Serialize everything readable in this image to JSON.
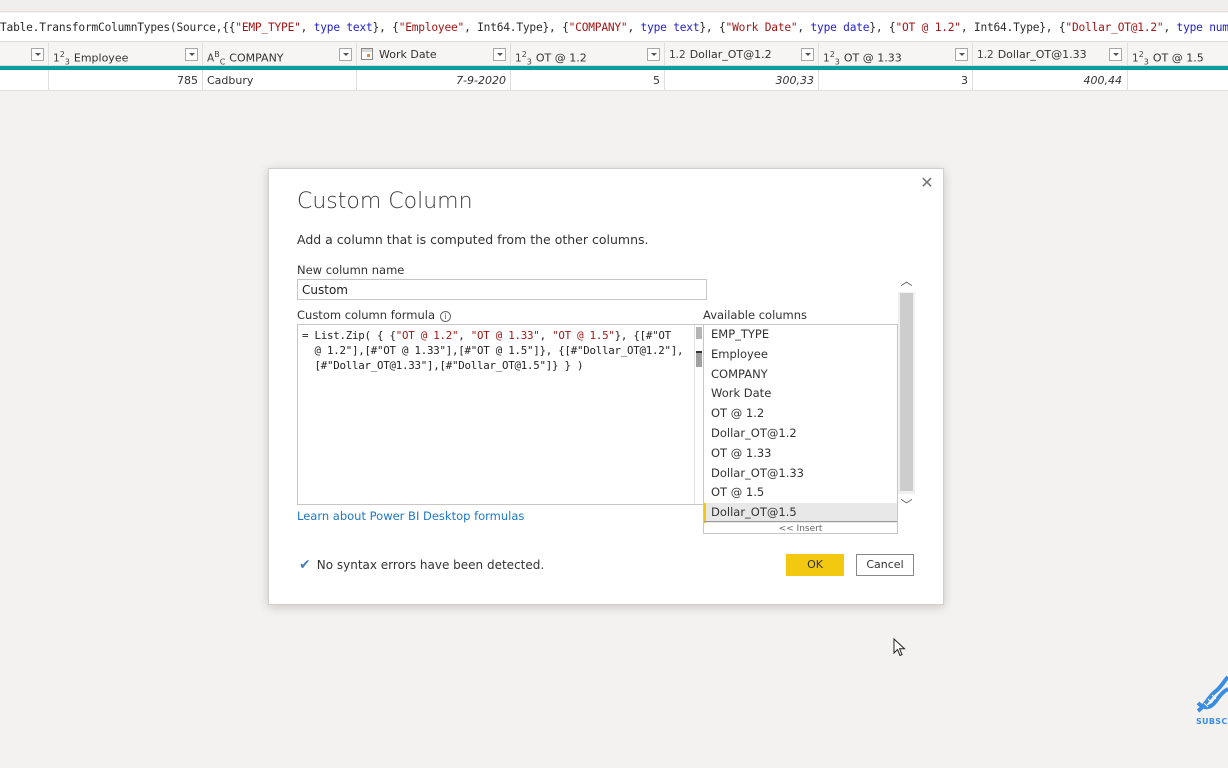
{
  "formula_bar": {
    "segments": [
      {
        "t": "Table.TransformColumnTypes(Source,{{",
        "c": ""
      },
      {
        "t": "\"EMP_TYPE\"",
        "c": "str"
      },
      {
        "t": ", ",
        "c": ""
      },
      {
        "t": "type text",
        "c": "kw"
      },
      {
        "t": "}, {",
        "c": ""
      },
      {
        "t": "\"Employee\"",
        "c": "str"
      },
      {
        "t": ", Int64.Type}, {",
        "c": ""
      },
      {
        "t": "\"COMPANY\"",
        "c": "str"
      },
      {
        "t": ", ",
        "c": ""
      },
      {
        "t": "type text",
        "c": "kw"
      },
      {
        "t": "}, {",
        "c": ""
      },
      {
        "t": "\"Work Date\"",
        "c": "str"
      },
      {
        "t": ", ",
        "c": ""
      },
      {
        "t": "type date",
        "c": "kw"
      },
      {
        "t": "}, {",
        "c": ""
      },
      {
        "t": "\"OT @ 1.2\"",
        "c": "str"
      },
      {
        "t": ", Int64.Type}, {",
        "c": ""
      },
      {
        "t": "\"Dollar_OT@1.2\"",
        "c": "str"
      },
      {
        "t": ", ",
        "c": ""
      },
      {
        "t": "type number",
        "c": "kw"
      },
      {
        "t": "},",
        "c": ""
      }
    ]
  },
  "grid": {
    "columns": [
      {
        "type_icon": "whole-number",
        "label": "Employee"
      },
      {
        "type_icon": "text",
        "label": "COMPANY"
      },
      {
        "type_icon": "date",
        "label": "Work Date"
      },
      {
        "type_icon": "whole-number",
        "label": "OT @ 1.2"
      },
      {
        "type_icon": "decimal",
        "label": "Dollar_OT@1.2"
      },
      {
        "type_icon": "whole-number",
        "label": "OT @ 1.33"
      },
      {
        "type_icon": "decimal",
        "label": "Dollar_OT@1.33"
      },
      {
        "type_icon": "whole-number",
        "label": "OT @ 1.5"
      }
    ],
    "row": [
      "785",
      "Cadbury",
      "7-9-2020",
      "5",
      "300,33",
      "3",
      "400,44",
      ""
    ]
  },
  "dialog": {
    "title": "Custom Column",
    "description": "Add a column that is computed from the other columns.",
    "new_column_label": "New column name",
    "new_column_value": "Custom",
    "formula_label": "Custom column formula",
    "formula_segments": [
      {
        "t": "= List.Zip( { {",
        "c": ""
      },
      {
        "t": "\"OT @ 1.2\"",
        "c": "str"
      },
      {
        "t": ", ",
        "c": ""
      },
      {
        "t": "\"OT @ 1.33\"",
        "c": "str"
      },
      {
        "t": ", ",
        "c": ""
      },
      {
        "t": "\"OT @ 1.5\"",
        "c": "str"
      },
      {
        "t": "}, {[#\"OT\n  @ 1.2\"],[#\"OT @ 1.33\"],[#\"OT @ 1.5\"]}, {[#\"Dollar_OT@1.2\"],\n  [#\"Dollar_OT@1.33\"],[#\"Dollar_OT@1.5\"]} } )",
        "c": ""
      }
    ],
    "available_label": "Available columns",
    "available_columns": [
      "EMP_TYPE",
      "Employee",
      "COMPANY",
      "Work Date",
      "OT @ 1.2",
      "Dollar_OT@1.2",
      "OT @ 1.33",
      "Dollar_OT@1.33",
      "OT @ 1.5",
      "Dollar_OT@1.5"
    ],
    "selected_column": "Dollar_OT@1.5",
    "insert_label": "<< Insert",
    "learn_link": "Learn about Power BI Desktop formulas",
    "status": "No syntax errors have been detected.",
    "ok_label": "OK",
    "cancel_label": "Cancel",
    "close_glyph": "✕"
  },
  "overlay": {
    "subscribe_label": "SUBSCRIBE"
  },
  "colors": {
    "accent_yellow": "#f2c811",
    "teal": "#0a9e9e",
    "link": "#1e78c8"
  }
}
